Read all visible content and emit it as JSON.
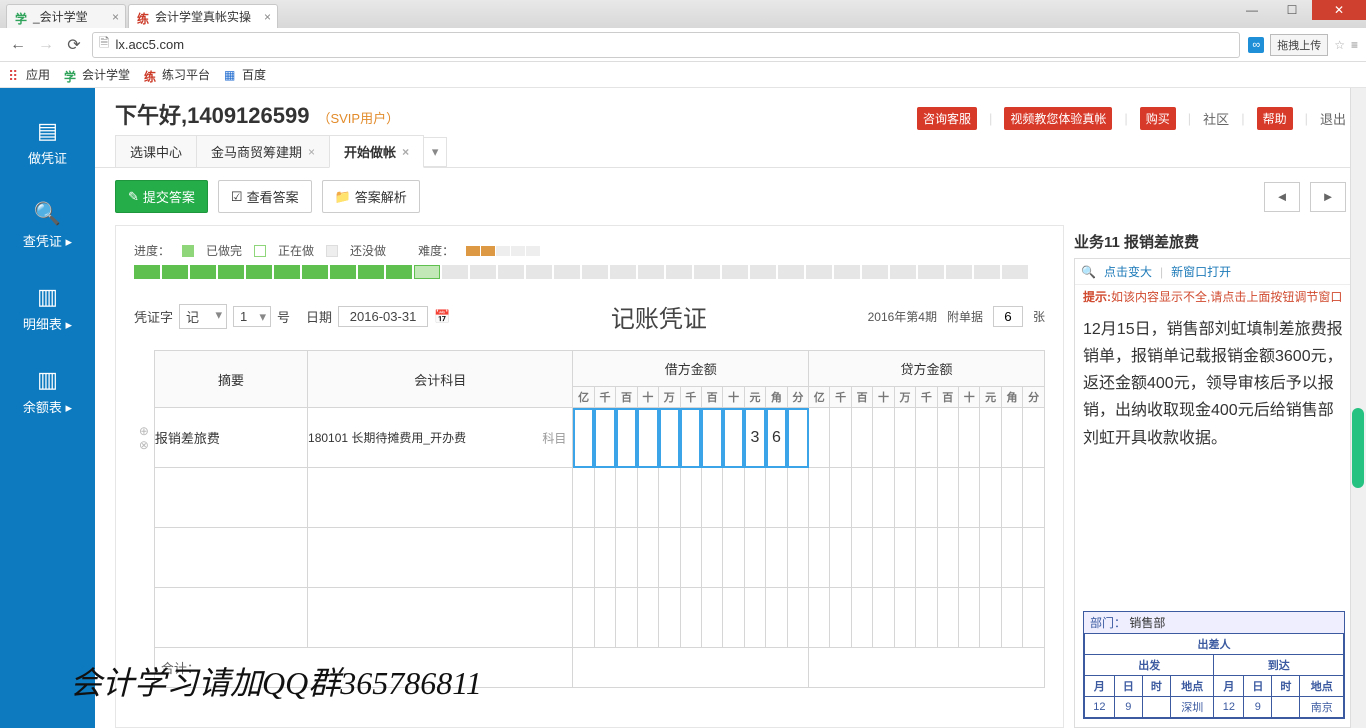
{
  "browser": {
    "tabs": [
      {
        "favicon": "学",
        "title": "_会计学堂",
        "color": "#2fa35a"
      },
      {
        "favicon": "练",
        "title": "会计学堂真帐实操",
        "color": "#cc3a28"
      }
    ],
    "url": "lx.acc5.com",
    "ext_label": "拖拽上传"
  },
  "bookmarks": {
    "apps": "应用",
    "items": [
      {
        "icon": "学",
        "color": "#2fa35a",
        "label": "会计学堂"
      },
      {
        "icon": "练",
        "color": "#cc3a28",
        "label": "练习平台"
      },
      {
        "icon": "▦",
        "color": "#1f6bd0",
        "label": "百度"
      }
    ]
  },
  "sidenav": [
    {
      "icon": "▤",
      "label": "做凭证"
    },
    {
      "icon": "🔍",
      "label": "查凭证 ▸"
    },
    {
      "icon": "▥",
      "label": "明细表 ▸"
    },
    {
      "icon": "▥",
      "label": "余额表 ▸"
    }
  ],
  "header": {
    "greeting": "下午好,1409126599",
    "svip": "（SVIP用户）",
    "links": {
      "consult": "咨询客服",
      "video": "视频教您体验真帐",
      "buy": "购买",
      "community": "社区",
      "help": "帮助",
      "logout": "退出"
    }
  },
  "pagetabs": [
    {
      "label": "选课中心",
      "active": false,
      "closable": false
    },
    {
      "label": "金马商贸筹建期",
      "active": false,
      "closable": true
    },
    {
      "label": "开始做帐",
      "active": true,
      "closable": true
    }
  ],
  "toolbar": {
    "submit": "提交答案",
    "view": "查看答案",
    "analysis": "答案解析"
  },
  "progress": {
    "label": "进度：",
    "done": "已做完",
    "doing": "正在做",
    "none": "还没做",
    "difficulty": "难度：",
    "cells": [
      "d",
      "d",
      "d",
      "d",
      "d",
      "d",
      "d",
      "d",
      "d",
      "d",
      "g",
      "e",
      "e",
      "e",
      "e",
      "e",
      "e",
      "e",
      "e",
      "e",
      "e",
      "e",
      "e",
      "e",
      "e",
      "e",
      "e",
      "e",
      "e",
      "e",
      "e",
      "e"
    ]
  },
  "voucher": {
    "pzz_label": "凭证字",
    "pzz_value": "记",
    "num_value": "1",
    "num_suffix": "号",
    "date_label": "日期",
    "date_value": "2016-03-31",
    "title": "记账凭证",
    "period": "2016年第4期",
    "attach_label": "附单据",
    "attach_value": "6",
    "attach_suffix": "张",
    "headers": {
      "summary": "摘要",
      "subject": "会计科目",
      "debit": "借方金额",
      "credit": "贷方金额"
    },
    "digit_units": [
      "亿",
      "千",
      "百",
      "十",
      "万",
      "千",
      "百",
      "十",
      "元",
      "角",
      "分"
    ],
    "rows": [
      {
        "summary": "报销差旅费",
        "subject": "180101 长期待摊费用_开办费",
        "subj_label": "科目",
        "debit": [
          "",
          "",
          "",
          "",
          "",
          "",
          "",
          "",
          "3",
          "6",
          ""
        ],
        "credit": [
          "",
          "",
          "",
          "",
          "",
          "",
          "",
          "",
          "",
          "",
          ""
        ]
      },
      {
        "summary": "",
        "subject": "",
        "debit": [
          "",
          "",
          "",
          "",
          "",
          "",
          "",
          "",
          "",
          "",
          ""
        ],
        "credit": [
          "",
          "",
          "",
          "",
          "",
          "",
          "",
          "",
          "",
          "",
          ""
        ]
      },
      {
        "summary": "",
        "subject": "",
        "debit": [
          "",
          "",
          "",
          "",
          "",
          "",
          "",
          "",
          "",
          "",
          ""
        ],
        "credit": [
          "",
          "",
          "",
          "",
          "",
          "",
          "",
          "",
          "",
          "",
          ""
        ]
      },
      {
        "summary": "",
        "subject": "",
        "debit": [
          "",
          "",
          "",
          "",
          "",
          "",
          "",
          "",
          "",
          "",
          ""
        ],
        "credit": [
          "",
          "",
          "",
          "",
          "",
          "",
          "",
          "",
          "",
          "",
          ""
        ]
      }
    ],
    "total": "合计："
  },
  "task": {
    "title": "业务11 报销差旅费",
    "zoom": "点击变大",
    "newwin": "新窗口打开",
    "hint_label": "提示:",
    "hint_text": "如该内容显示不全,请点击上面按钮调节窗口",
    "description": "12月15日，销售部刘虹填制差旅费报销单，报销单记载报销金额3600元，返还金额400元，领导审核后予以报销，出纳收取现金400元后给销售部刘虹开具收款收据。",
    "dept_label": "部门：",
    "dept_value": "销售部",
    "travel_person": "出差人",
    "depart": "出发",
    "arrive": "到达",
    "sub_cols": [
      "月",
      "日",
      "时",
      "地点",
      "月",
      "日",
      "时",
      "地点"
    ],
    "sub_row": [
      "12",
      "9",
      "",
      "深圳",
      "12",
      "9",
      "",
      "南京"
    ]
  },
  "overlay": "会计学习请加QQ群365786811"
}
